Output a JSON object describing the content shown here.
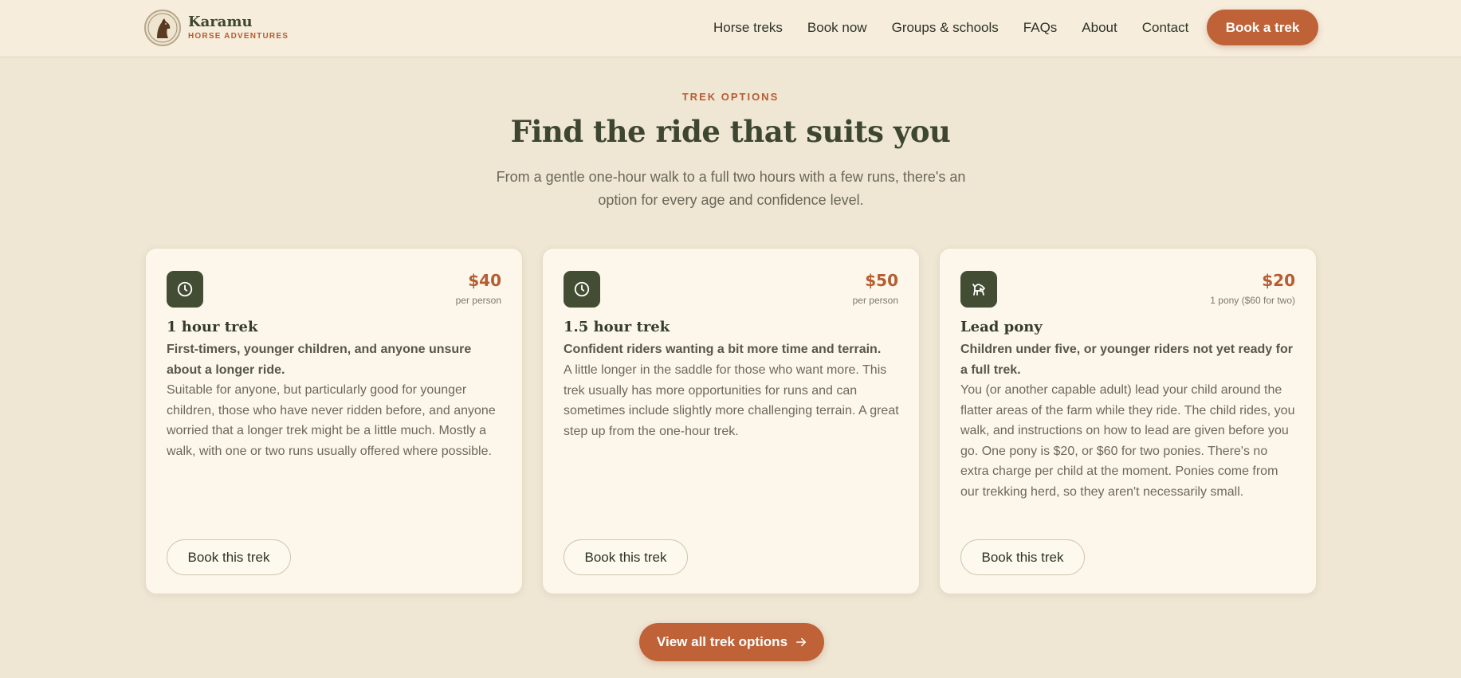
{
  "header": {
    "brand_name": "Karamu",
    "brand_tagline": "HORSE ADVENTURES",
    "nav": [
      {
        "label": "Horse treks"
      },
      {
        "label": "Book now"
      },
      {
        "label": "Groups & schools"
      },
      {
        "label": "FAQs"
      },
      {
        "label": "About"
      },
      {
        "label": "Contact"
      }
    ],
    "cta_label": "Book a trek"
  },
  "section": {
    "eyebrow": "TREK OPTIONS",
    "title": "Find the ride that suits you",
    "subtitle": "From a gentle one-hour walk to a full two hours with a few runs, there's an option for every age and confidence level."
  },
  "cards": [
    {
      "icon": "clock-icon",
      "price": "$40",
      "unit": "per person",
      "title": "1 hour trek",
      "audience": "First-timers, younger children, and anyone unsure about a longer ride.",
      "description": "Suitable for anyone, but particularly good for younger children, those who have never ridden before, and anyone worried that a longer trek might be a little much. Mostly a walk, with one or two runs usually offered where possible.",
      "button": "Book this trek"
    },
    {
      "icon": "clock-icon",
      "price": "$50",
      "unit": "per person",
      "title": "1.5 hour trek",
      "audience": "Confident riders wanting a bit more time and terrain.",
      "description": "A little longer in the saddle for those who want more. This trek usually has more opportunities for runs and can sometimes include slightly more challenging terrain. A great step up from the one-hour trek.",
      "button": "Book this trek"
    },
    {
      "icon": "pony-icon",
      "price": "$20",
      "unit": "1 pony ($60 for two)",
      "title": "Lead pony",
      "audience": "Children under five, or younger riders not yet ready for a full trek.",
      "description": "You (or another capable adult) lead your child around the flatter areas of the farm while they ride. The child rides, you walk, and instructions on how to lead are given before you go. One pony is $20, or $60 for two ponies. There's no extra charge per child at the moment. Ponies come from our trekking herd, so they aren't necessarily small.",
      "button": "Book this trek"
    }
  ],
  "view_all_label": "View all trek options",
  "colors": {
    "background": "#efe6d4",
    "accent": "#bf6238",
    "dark_green": "#434d33",
    "card": "#fcf7ea"
  }
}
